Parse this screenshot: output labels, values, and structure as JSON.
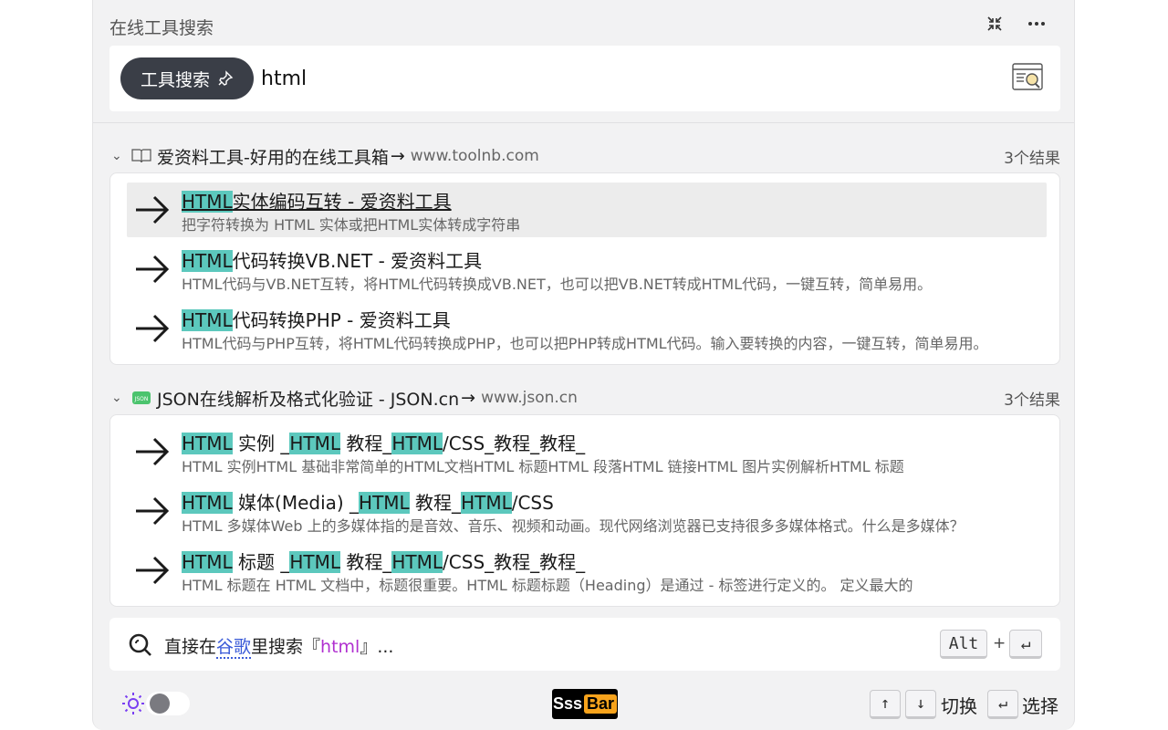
{
  "app": {
    "title": "在线工具搜索"
  },
  "search": {
    "mode_label": "工具搜索",
    "query": "html"
  },
  "groups": [
    {
      "site_name": "爱资料工具-好用的在线工具箱",
      "arrow": "→",
      "url": "www.toolnb.com",
      "count": "3个结果",
      "icon": "book-icon",
      "items": [
        {
          "hl": "HTML",
          "title_rest": "实体编码互转 - 爱资料工具",
          "desc": "把字符转换为 HTML 实体或把HTML实体转成字符串"
        },
        {
          "hl": "HTML",
          "title_rest": "代码转换VB.NET - 爱资料工具",
          "desc": "HTML代码与VB.NET互转，将HTML代码转换成VB.NET，也可以把VB.NET转成HTML代码，一键互转，简单易用。"
        },
        {
          "hl": "HTML",
          "title_rest": "代码转换PHP - 爱资料工具",
          "desc": "HTML代码与PHP互转，将HTML代码转换成PHP，也可以把PHP转成HTML代码。输入要转换的内容，一键互转，简单易用。"
        }
      ]
    },
    {
      "site_name": "JSON在线解析及格式化验证 - JSON.cn",
      "arrow": "→",
      "url": "www.json.cn",
      "count": "3个结果",
      "icon": "json-icon",
      "items": [
        {
          "t1": "HTML",
          "t2": " 实例 _",
          "t3": "HTML",
          "t4": " 教程_",
          "t5": "HTML",
          "t6": "/CSS_教程_教程_",
          "desc": "HTML 实例HTML 基础非常简单的HTML文档HTML 标题HTML 段落HTML 链接HTML 图片实例解析HTML 标题"
        },
        {
          "t1": "HTML",
          "t2": " 媒体(Media) _",
          "t3": "HTML",
          "t4": " 教程_",
          "t5": "HTML",
          "t6": "/CSS",
          "desc": "HTML 多媒体Web 上的多媒体指的是音效、音乐、视频和动画。现代网络浏览器已支持很多多媒体格式。什么是多媒体？"
        },
        {
          "t1": "HTML",
          "t2": " 标题 _",
          "t3": "HTML",
          "t4": " 教程_",
          "t5": "HTML",
          "t6": "/CSS_教程_教程_",
          "desc": "HTML 标题在 HTML 文档中，标题很重要。HTML 标题标题（Heading）是通过 - 标签进行定义的。 定义最大的"
        }
      ]
    }
  ],
  "google": {
    "prefix": "直接在",
    "engine": "谷歌",
    "middle": "里搜索『",
    "query": "html",
    "suffix": "』...",
    "key_alt": "Alt",
    "key_plus": "+",
    "key_enter": "↵"
  },
  "footer": {
    "brand_a": "Sss",
    "brand_b": "Bar",
    "key_up": "↑",
    "key_down": "↓",
    "switch_label": "切换",
    "key_enter": "↵",
    "select_label": "选择"
  },
  "colors": {
    "highlight": "#5cc8bd",
    "pill": "#3a3e47",
    "link": "#3b5bd8",
    "query": "#b02fd0",
    "brand_orange": "#f7a31c"
  }
}
